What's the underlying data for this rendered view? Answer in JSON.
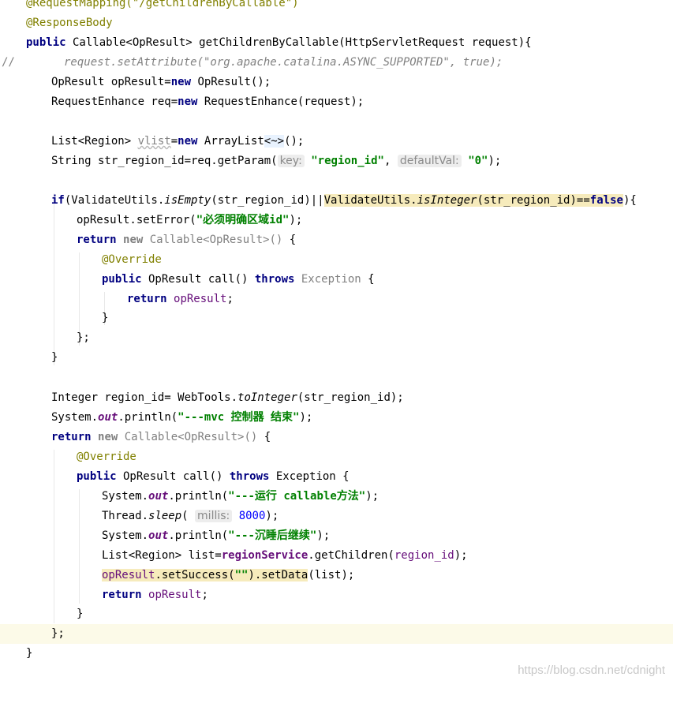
{
  "editor": {
    "comment_marker": "//",
    "tokens": {
      "request_mapping": "@RequestMapping(\"/getChildrenByCallable\")",
      "response_body": "@ResponseBody",
      "kw_public": "public",
      "sig_rest": " Callable<OpResult> getChildrenByCallable(HttpServletRequest request){",
      "commented_line": "request.setAttribute(\"org.apache.catalina.ASYNC_SUPPORTED\", true);",
      "opresult_decl": "OpResult opResult=",
      "kw_new": "new",
      "opresult_ctor": " OpResult();",
      "req_decl": "RequestEnhance req=",
      "req_ctor": " RequestEnhance(request);",
      "list_type": "List<Region> ",
      "vlist": "vlist",
      "eq": "=",
      "arraylist": " ArrayList",
      "diamond": "<~>",
      "call_end": "();",
      "string_decl": "String str_region_id=req.getParam(",
      "hint_key": "key:",
      "str_region_id": "\"region_id\"",
      "comma": ", ",
      "hint_default": "defaultVal:",
      "str_zero": "\"0\"",
      "close_stmt": ");",
      "kw_if": "if",
      "if_open": "(ValidateUtils.",
      "is_empty": "isEmpty",
      "if_mid": "(str_region_id)||",
      "hl_validate": "ValidateUtils.",
      "is_integer": "isInteger",
      "hl_arg": "(str_region_id)==",
      "kw_false": "false",
      "if_close": "){",
      "set_error": "opResult.setError(",
      "str_error": "\"必须明确区域id\"",
      "kw_return": "return",
      "callable_gray": " Callable<OpResult>() ",
      "open_brace": "{",
      "override": "@Override",
      "call_sig": " OpResult call() ",
      "kw_throws": "throws",
      "exception_gray": " Exception ",
      "opresult_field": "opResult",
      "semicolon": ";",
      "close_brace": "}",
      "close_anon": "};",
      "integer_decl": "Integer region_id= WebTools.",
      "to_integer": "toInteger",
      "integer_arg": "(str_region_id);",
      "system": "System.",
      "out": "out",
      "println": ".println(",
      "str_end": "\"---mvc 控制器 结束\"",
      "exception": " Exception {",
      "str_run": "\"---运行 callable方法\"",
      "thread": "Thread.",
      "sleep": "sleep",
      "paren_open": "(",
      "hint_millis": "millis:",
      "num_8000": "8000",
      "str_wake": "\"---沉睡后继续\"",
      "list_decl": "List<Region> list=",
      "region_service": "regionService",
      "get_children": ".getChildren(",
      "region_id": "region_id",
      "set_success": ".setSuccess(",
      "str_empty": "\"\"",
      "set_data": ").setData",
      "set_data_args": "(list);"
    }
  },
  "watermark": "https://blog.csdn.net/cdnight"
}
